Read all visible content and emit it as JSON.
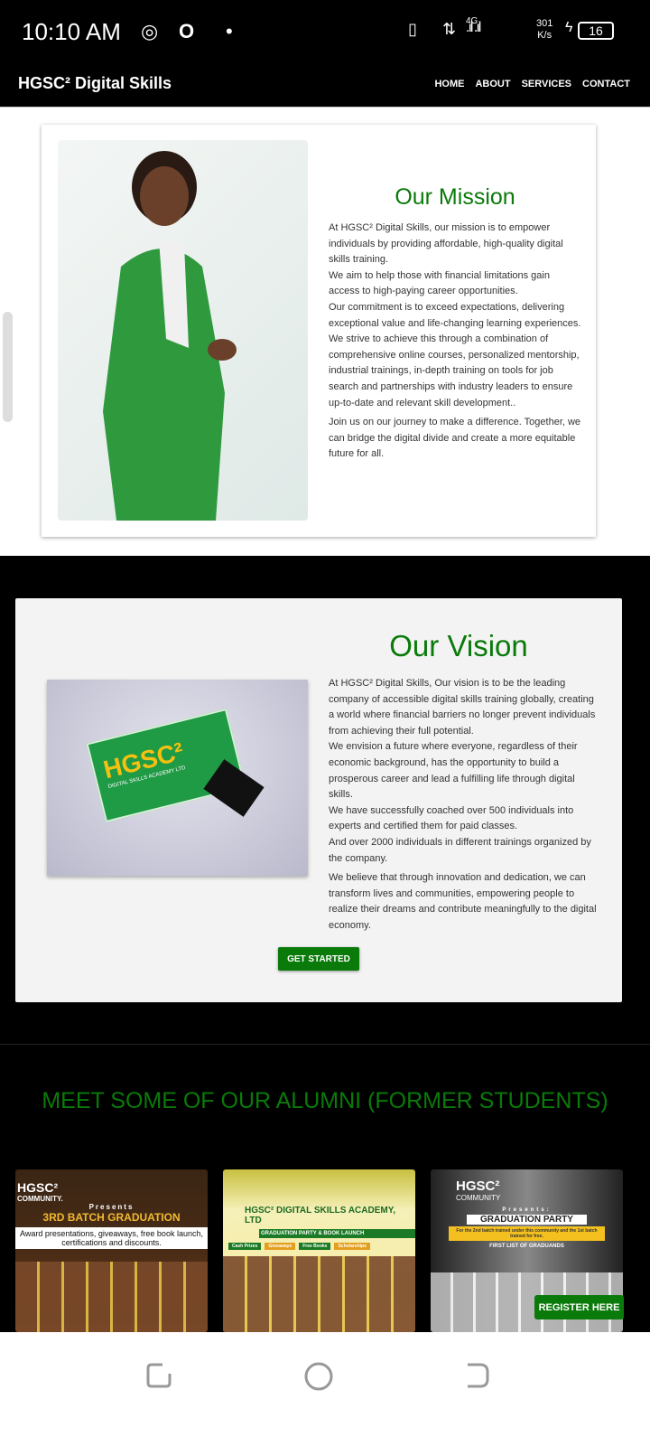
{
  "status_bar": {
    "time": "10:10 AM",
    "network": "4G",
    "speed_value": "301",
    "speed_unit": "K/s",
    "battery": "16"
  },
  "nav": {
    "brand": "HGSC² Digital Skills",
    "links": [
      "HOME",
      "ABOUT",
      "SERVICES",
      "CONTACT"
    ]
  },
  "mission": {
    "title": "Our Mission",
    "paragraphs": [
      "At HGSC² Digital Skills, our mission is to empower individuals by providing affordable, high-quality digital skills training.\nWe aim to help those with financial limitations gain access to high-paying career opportunities.\nOur commitment is to exceed expectations, delivering exceptional value and life-changing learning experiences. We strive to achieve this through a combination of comprehensive online courses, personalized mentorship, industrial trainings, in-depth training on tools for job search and partnerships with industry leaders to ensure up-to-date and relevant skill development..",
      "Join us on our journey to make a difference. Together, we can bridge the digital divide and create a more equitable future for all."
    ]
  },
  "vision": {
    "title": "Our Vision",
    "card_logo": "HGSC²",
    "card_sub": "DIGITAL SKILLS ACADEMY LTD",
    "paragraphs": [
      "At HGSC² Digital Skills, Our vision is to be the leading company of accessible digital skills training globally, creating a world where financial barriers no longer prevent individuals from achieving their full potential.\nWe envision a future where everyone, regardless of their economic background, has the opportunity to build a prosperous career and lead a fulfilling life through digital skills.\nWe have successfully coached over 500 individuals into experts and certified them for paid classes.\nAnd over 2000 individuals in different trainings organized by the company.",
      "We believe that through innovation and dedication, we can transform lives and communities, empowering people to realize their dreams and contribute meaningfully to the digital economy."
    ],
    "button": "GET STARTED"
  },
  "alumni": {
    "title": "MEET SOME OF OUR ALUMNI (FORMER STUDENTS)",
    "cards": [
      {
        "brand": "HGSC²",
        "community": "COMMUNITY.",
        "presents": "Presents",
        "headline": "3RD BATCH GRADUATION",
        "sub": "Award presentations, giveaways, free book launch, certifications and discounts."
      },
      {
        "brand": "HGSC² DIGITAL SKILLS ACADEMY, LTD",
        "headline": "GRADUATION PARTY & BOOK LAUNCH",
        "tags": [
          "Cash Prizes",
          "Giveaways",
          "Free Books",
          "Scholarships"
        ]
      },
      {
        "brand": "HGSC²",
        "community": "COMMUNITY",
        "presents": "Presents:",
        "headline": "GRADUATION PARTY",
        "sub": "For the 2nd batch trained under this community and the 1st batch trained for free.",
        "list": "FIRST LIST OF GRADUANDS"
      }
    ]
  },
  "register_button": "REGISTER HERE",
  "colors": {
    "accent": "#0a7a0a",
    "dark": "#000000",
    "card": "#f3f3f3"
  }
}
